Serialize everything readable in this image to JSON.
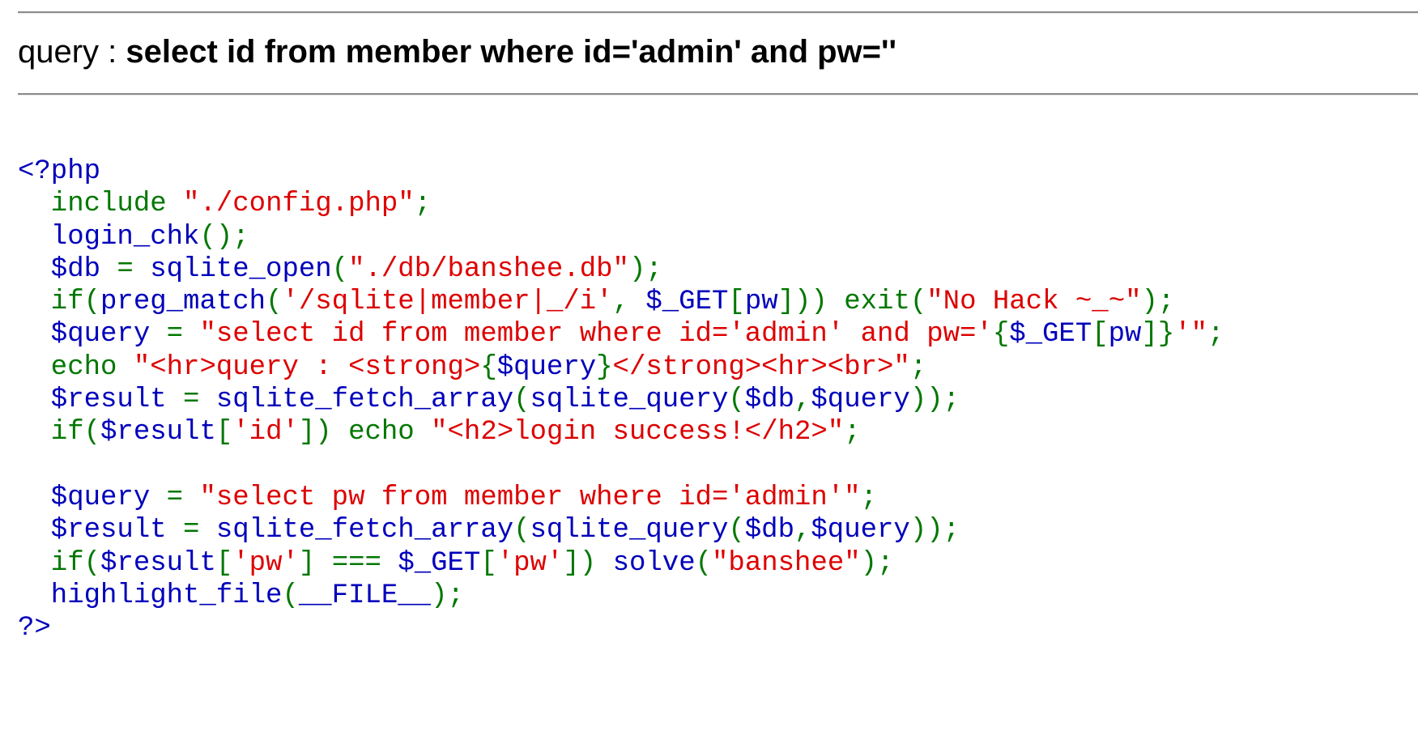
{
  "header": {
    "label": "query : ",
    "query": "select id from member where id='admin' and pw=''"
  },
  "colors": {
    "keyword": "#007700",
    "default": "#0000bb",
    "string": "#dd0000",
    "rule": "#8c8c8c"
  },
  "code": {
    "lines": [
      [
        [
          "df",
          "<?php"
        ]
      ],
      [
        [
          "kw",
          "  include "
        ],
        [
          "st",
          "\"./config.php\""
        ],
        [
          "kw",
          ";"
        ]
      ],
      [
        [
          "df",
          "  login_chk"
        ],
        [
          "kw",
          "();"
        ]
      ],
      [
        [
          "df",
          "  $db "
        ],
        [
          "kw",
          "= "
        ],
        [
          "df",
          "sqlite_open"
        ],
        [
          "kw",
          "("
        ],
        [
          "st",
          "\"./db/banshee.db\""
        ],
        [
          "kw",
          ");"
        ]
      ],
      [
        [
          "kw",
          "  if("
        ],
        [
          "df",
          "preg_match"
        ],
        [
          "kw",
          "("
        ],
        [
          "st",
          "'/sqlite|member|_/i'"
        ],
        [
          "kw",
          ", "
        ],
        [
          "df",
          "$_GET"
        ],
        [
          "kw",
          "["
        ],
        [
          "df",
          "pw"
        ],
        [
          "kw",
          "])) exit("
        ],
        [
          "st",
          "\"No Hack ~_~\""
        ],
        [
          "kw",
          ");"
        ]
      ],
      [
        [
          "df",
          "  $query "
        ],
        [
          "kw",
          "= "
        ],
        [
          "st",
          "\"select id from member where id='admin' and pw='"
        ],
        [
          "kw",
          "{"
        ],
        [
          "df",
          "$_GET"
        ],
        [
          "kw",
          "["
        ],
        [
          "df",
          "pw"
        ],
        [
          "kw",
          "]}"
        ],
        [
          "st",
          "'\""
        ],
        [
          "kw",
          ";"
        ]
      ],
      [
        [
          "kw",
          "  echo "
        ],
        [
          "st",
          "\"<hr>query : <strong>"
        ],
        [
          "kw",
          "{"
        ],
        [
          "df",
          "$query"
        ],
        [
          "kw",
          "}"
        ],
        [
          "st",
          "</strong><hr><br>\""
        ],
        [
          "kw",
          ";"
        ]
      ],
      [
        [
          "df",
          "  $result "
        ],
        [
          "kw",
          "= "
        ],
        [
          "df",
          "sqlite_fetch_array"
        ],
        [
          "kw",
          "("
        ],
        [
          "df",
          "sqlite_query"
        ],
        [
          "kw",
          "("
        ],
        [
          "df",
          "$db"
        ],
        [
          "kw",
          ","
        ],
        [
          "df",
          "$query"
        ],
        [
          "kw",
          "));"
        ]
      ],
      [
        [
          "kw",
          "  if("
        ],
        [
          "df",
          "$result"
        ],
        [
          "kw",
          "["
        ],
        [
          "st",
          "'id'"
        ],
        [
          "kw",
          "]) echo "
        ],
        [
          "st",
          "\"<h2>login success!</h2>\""
        ],
        [
          "kw",
          ";"
        ]
      ],
      [],
      [
        [
          "df",
          "  $query "
        ],
        [
          "kw",
          "= "
        ],
        [
          "st",
          "\"select pw from member where id='admin'\""
        ],
        [
          "kw",
          ";"
        ]
      ],
      [
        [
          "df",
          "  $result "
        ],
        [
          "kw",
          "= "
        ],
        [
          "df",
          "sqlite_fetch_array"
        ],
        [
          "kw",
          "("
        ],
        [
          "df",
          "sqlite_query"
        ],
        [
          "kw",
          "("
        ],
        [
          "df",
          "$db"
        ],
        [
          "kw",
          ","
        ],
        [
          "df",
          "$query"
        ],
        [
          "kw",
          "));"
        ]
      ],
      [
        [
          "kw",
          "  if("
        ],
        [
          "df",
          "$result"
        ],
        [
          "kw",
          "["
        ],
        [
          "st",
          "'pw'"
        ],
        [
          "kw",
          "] === "
        ],
        [
          "df",
          "$_GET"
        ],
        [
          "kw",
          "["
        ],
        [
          "st",
          "'pw'"
        ],
        [
          "kw",
          "]) "
        ],
        [
          "df",
          "solve"
        ],
        [
          "kw",
          "("
        ],
        [
          "st",
          "\"banshee\""
        ],
        [
          "kw",
          ");"
        ]
      ],
      [
        [
          "df",
          "  highlight_file"
        ],
        [
          "kw",
          "("
        ],
        [
          "df",
          "__FILE__"
        ],
        [
          "kw",
          ");"
        ]
      ],
      [
        [
          "df",
          "?>"
        ]
      ]
    ]
  }
}
